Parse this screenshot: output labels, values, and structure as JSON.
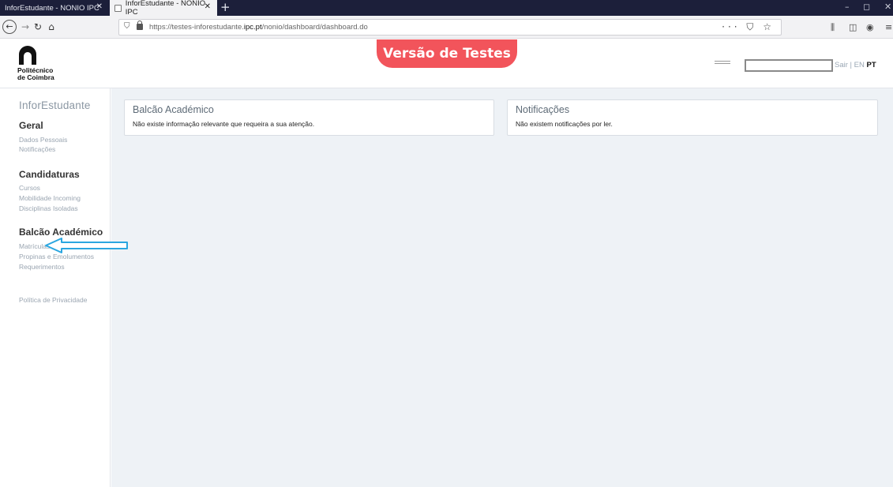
{
  "browser": {
    "tabs": [
      {
        "title": "InforEstudante - NONIO IPC",
        "active": false
      },
      {
        "title": "InforEstudante - NONIO IPC",
        "active": true
      }
    ],
    "new_tab": "+",
    "window_controls": {
      "minimize": "–",
      "restore": "◻",
      "close": "✕"
    },
    "url_prefix": "https://testes-inforestudante.",
    "url_domain": "ipc.pt",
    "url_path": "/nonio/dashboard/dashboard.do",
    "url_actions": "··· ⛉ ☆",
    "toolbar_icons": [
      "library-icon",
      "sidebar-icon",
      "account-icon",
      "menu-icon"
    ]
  },
  "header": {
    "logo_line1": "Politécnico",
    "logo_line2": "de Coimbra",
    "test_banner": "Versão de Testes",
    "logout": "Sair",
    "separator": "|",
    "lang_en": "EN",
    "lang_pt": "PT"
  },
  "sidebar": {
    "app_title": "InforEstudante",
    "sections": [
      {
        "title": "Geral",
        "items": [
          "Dados Pessoais",
          "Notificações"
        ]
      },
      {
        "title": "Candidaturas",
        "items": [
          "Cursos",
          "Mobilidade Incoming",
          "Disciplinas Isoladas"
        ]
      },
      {
        "title": "Balcão Académico",
        "items": [
          "Matrículas",
          "Propinas e Emolumentos",
          "Requerimentos"
        ]
      }
    ],
    "privacy": "Política de Privacidade"
  },
  "cards": [
    {
      "title": "Balcão Académico",
      "body": "Não existe informação relevante que requeira a sua atenção."
    },
    {
      "title": "Notificações",
      "body": "Não existem notificações por ler."
    }
  ],
  "colors": {
    "tabbar": "#1c1f3a",
    "banner": "#f2545b",
    "main_bg": "#eef2f6",
    "arrow": "#2aa6e0"
  }
}
